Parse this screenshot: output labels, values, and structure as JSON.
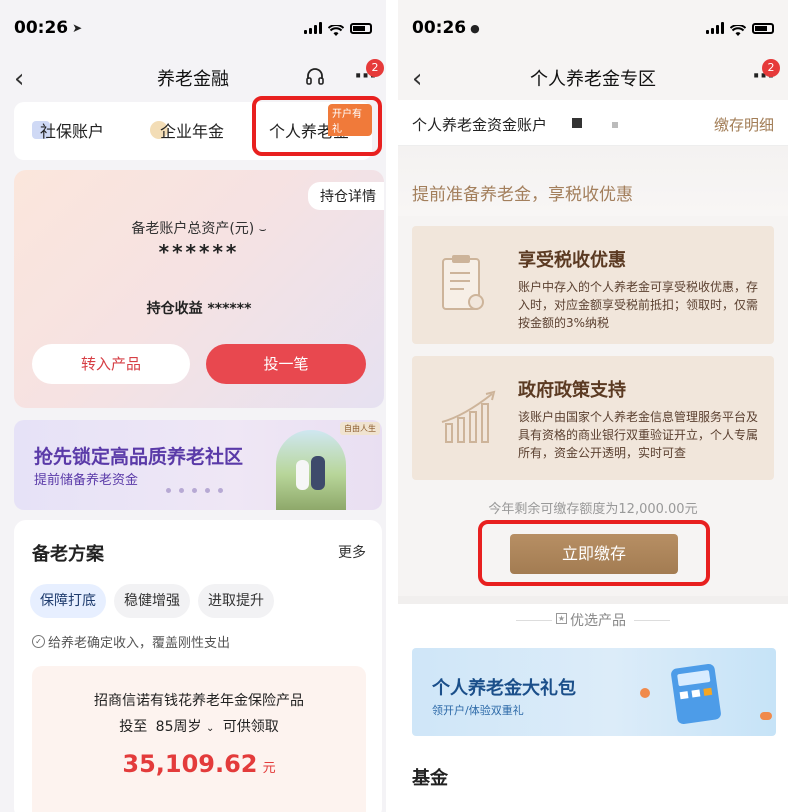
{
  "left": {
    "status": {
      "time": "00:26"
    },
    "nav": {
      "title": "养老金融",
      "badge": "2"
    },
    "account_tabs": [
      {
        "label": "社保账户"
      },
      {
        "label": "企业年金"
      },
      {
        "label": "个人养老金",
        "tag": "开户有礼"
      }
    ],
    "asset_card": {
      "detail_button": "持仓详情",
      "total_label": "备老账户总资产(元)",
      "total_value": "******",
      "profit_label": "持仓收益",
      "profit_value": "******",
      "transfer_button": "转入产品",
      "invest_button": "投一笔"
    },
    "banner": {
      "tag": "自由人生",
      "title": "抢先锁定高品质养老社区",
      "subtitle": "提前储备养老资金"
    },
    "plan": {
      "title": "备老方案",
      "more": "更多",
      "chips": [
        "保障打底",
        "稳健增强",
        "进取提升"
      ],
      "note": "给养老确定收入，覆盖刚性支出",
      "product": {
        "name": "招商信诺有钱花养老年金保险产品",
        "age_prefix": "投至",
        "age_value": "85周岁",
        "age_suffix": "可供领取",
        "amount": "35,109.62",
        "amount_unit": "元"
      }
    }
  },
  "right": {
    "status": {
      "time": "00:26"
    },
    "nav": {
      "title": "个人养老金专区",
      "badge": "2"
    },
    "account_row": {
      "label": "个人养老金资金账户",
      "detail_link": "缴存明细"
    },
    "slogan": "提前准备养老金，享税收优惠",
    "features": [
      {
        "title": "享受税收优惠",
        "desc": "账户中存入的个人养老金可享受税收优惠，存入时，对应金额享受税前抵扣；领取时，仅需按金额的3%纳税"
      },
      {
        "title": "政府政策支持",
        "desc": "该账户由国家个人养老金信息管理服务平台及具有资格的商业银行双重验证开立，个人专属所有，资金公开透明，实时可查"
      }
    ],
    "quota_text": "今年剩余可缴存额度为12,000.00元",
    "deposit_button": "立即缴存",
    "section_title": "优选产品",
    "promo": {
      "title": "个人养老金大礼包",
      "subtitle": "领开户/体验双重礼"
    },
    "fund_heading": "基金"
  },
  "colors": {
    "accent_red": "#e8201f",
    "button_red": "#e8484f",
    "gold": "#a97f55"
  }
}
